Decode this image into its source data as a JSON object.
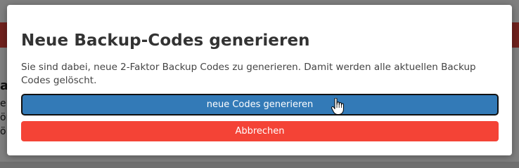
{
  "background": {
    "top_text": "",
    "fragments": [
      "a",
      "e",
      "ör",
      "ö"
    ]
  },
  "modal": {
    "title": "Neue Backup-Codes generieren",
    "text": "Sie sind dabei, neue 2-Faktor Backup Codes zu generieren. Damit werden alle aktuellen Backup Codes gelöscht.",
    "confirm_label": "neue Codes generieren",
    "cancel_label": "Abbrechen"
  },
  "colors": {
    "primary": "#337ab7",
    "danger": "#f44336",
    "header_bar": "#e0433a"
  },
  "icons": {
    "cursor": "hand-pointer-cursor"
  }
}
